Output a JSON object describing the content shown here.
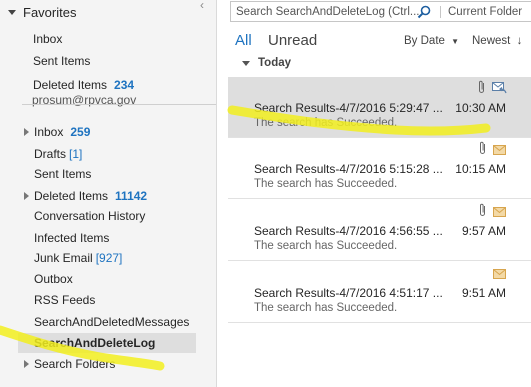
{
  "nav": {
    "favorites_label": "Favorites",
    "favorites": [
      {
        "label": "Inbox",
        "count": ""
      },
      {
        "label": "Sent Items",
        "count": ""
      },
      {
        "label": "Deleted Items",
        "count": "234"
      }
    ],
    "account": "prosum@rpvca.gov",
    "folders": [
      {
        "label": "Inbox",
        "count": "259",
        "expandable": true
      },
      {
        "label": "Drafts",
        "count": "[1]"
      },
      {
        "label": "Sent Items",
        "count": ""
      },
      {
        "label": "Deleted Items",
        "count": "11142",
        "expandable": true
      },
      {
        "label": "Conversation History",
        "count": ""
      },
      {
        "label": "Infected Items",
        "count": ""
      },
      {
        "label": "Junk Email",
        "count": "[927]"
      },
      {
        "label": "Outbox",
        "count": ""
      },
      {
        "label": "RSS Feeds",
        "count": ""
      },
      {
        "label": "SearchAndDeletedMessages",
        "count": ""
      },
      {
        "label": "SearchAndDeleteLog",
        "count": "",
        "selected": true
      },
      {
        "label": "Search Folders",
        "count": "",
        "expandable": true
      }
    ]
  },
  "search": {
    "placeholder": "Search SearchAndDeleteLog (Ctrl...",
    "scope": "Current Folder"
  },
  "filters": {
    "all": "All",
    "unread": "Unread"
  },
  "sort": {
    "by": "By Date",
    "direction": "Newest"
  },
  "group": {
    "label": "Today"
  },
  "messages": [
    {
      "subject": "Search Results-4/7/2016 5:29:47 ...",
      "preview": "The search has Succeeded.",
      "time": "10:30 AM",
      "attachment": true,
      "icon": "envelope-reply-icon",
      "selected": true
    },
    {
      "subject": "Search Results-4/7/2016 5:15:28 ...",
      "preview": "The search has Succeeded.",
      "time": "10:15 AM",
      "attachment": true,
      "icon": "envelope-icon"
    },
    {
      "subject": "Search Results-4/7/2016 4:56:55 ...",
      "preview": "The search has Succeeded.",
      "time": "9:57 AM",
      "attachment": true,
      "icon": "envelope-icon"
    },
    {
      "subject": "Search Results-4/7/2016 4:51:17 ...",
      "preview": "The search has Succeeded.",
      "time": "9:51 AM",
      "attachment": false,
      "icon": "envelope-icon"
    }
  ],
  "colors": {
    "accent": "#1e73c0",
    "highlight": "#f2ee1e",
    "selection": "#dedede"
  }
}
